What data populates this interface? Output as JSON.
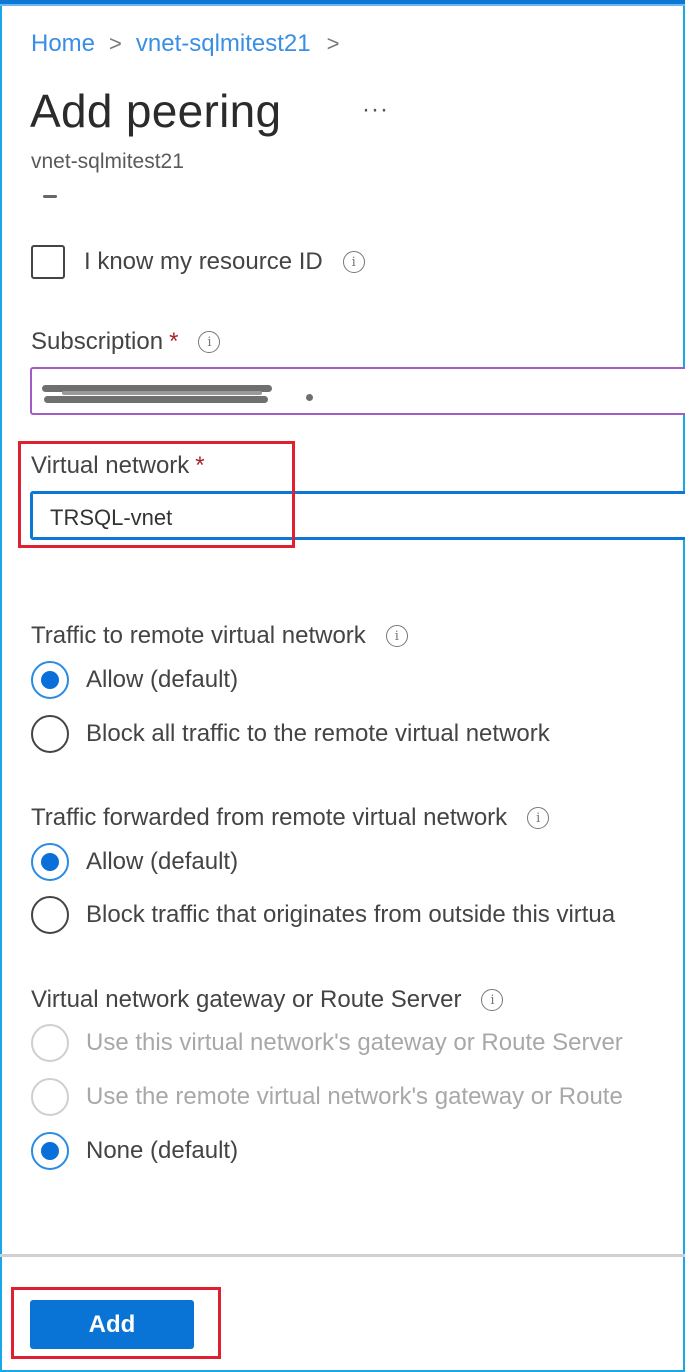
{
  "breadcrumb": {
    "items": [
      "Home",
      "vnet-sqlmitest21"
    ],
    "separator": ">"
  },
  "header": {
    "title": "Add peering",
    "more_label": "···",
    "subtitle": "vnet-sqlmitest21"
  },
  "form": {
    "resource_id_checkbox": {
      "label": "I know my resource ID",
      "checked": false
    },
    "subscription": {
      "label": "Subscription",
      "required_mark": "*",
      "value": "[redacted]"
    },
    "virtual_network": {
      "label": "Virtual network",
      "required_mark": "*",
      "value": "TRSQL-vnet"
    },
    "traffic_to_remote": {
      "label": "Traffic to remote virtual network",
      "options": [
        {
          "label": "Allow (default)",
          "selected": true,
          "disabled": false
        },
        {
          "label": "Block all traffic to the remote virtual network",
          "selected": false,
          "disabled": false
        }
      ]
    },
    "traffic_forwarded": {
      "label": "Traffic forwarded from remote virtual network",
      "options": [
        {
          "label": "Allow (default)",
          "selected": true,
          "disabled": false
        },
        {
          "label": "Block traffic that originates from outside this virtua",
          "selected": false,
          "disabled": false
        }
      ]
    },
    "gateway": {
      "label": "Virtual network gateway or Route Server",
      "options": [
        {
          "label": "Use this virtual network's gateway or Route Server",
          "selected": false,
          "disabled": true
        },
        {
          "label": "Use the remote virtual network's gateway or Route",
          "selected": false,
          "disabled": true
        },
        {
          "label": "None (default)",
          "selected": true,
          "disabled": false
        }
      ]
    }
  },
  "footer": {
    "add_label": "Add"
  },
  "icons": {
    "info": "i"
  },
  "colors": {
    "accent": "#0a78d4",
    "link": "#3a8ee6",
    "required": "#a4262c",
    "annotation": "#e02030",
    "subscription_focus": "#a35bc6"
  }
}
